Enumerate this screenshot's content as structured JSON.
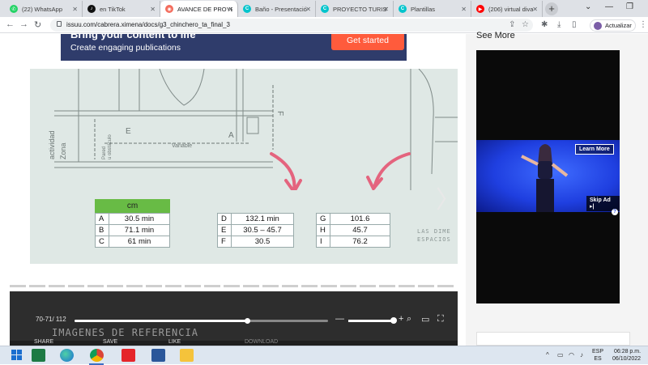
{
  "browser": {
    "tabs": [
      {
        "label": "(22) WhatsApp",
        "icon": "whatsapp-icon",
        "color": "#25d366"
      },
      {
        "label": "en TikTok",
        "icon": "tiktok-icon",
        "color": "#111111"
      },
      {
        "label": "AVANCE DE PROYE",
        "icon": "issuu-icon",
        "color": "#f36d5d"
      },
      {
        "label": "Baño - Presentació",
        "icon": "canva-icon",
        "color": "#00c4cc"
      },
      {
        "label": "PROYECTO TURIST",
        "icon": "canva-icon",
        "color": "#00c4cc"
      },
      {
        "label": "Plantillas",
        "icon": "canva-icon",
        "color": "#00c4cc"
      },
      {
        "label": "(206) virtual diva",
        "icon": "youtube-icon",
        "color": "#ff0000"
      }
    ],
    "active_tab_index": 2,
    "new_tab": "+",
    "window_controls": {
      "tab_search": "⌄",
      "minimize": "—",
      "restore": "❐"
    },
    "url": "issuu.com/cabrera.ximena/docs/g3_chinchero_ta_final_3",
    "update_label": "Actualizar"
  },
  "promo": {
    "title": "Bring your content to life",
    "subtitle": "Create engaging publications",
    "cta": "Get started",
    "bg_color": "#2f3c6b",
    "cta_color": "#ff5b3c"
  },
  "document": {
    "table_header": "cm",
    "table1": [
      [
        "A",
        "30.5 min"
      ],
      [
        "B",
        "71.1 min"
      ],
      [
        "C",
        "61 min"
      ]
    ],
    "table2": [
      [
        "D",
        "132.1 min"
      ],
      [
        "E",
        "30.5 – 45.7"
      ],
      [
        "F",
        "30.5"
      ]
    ],
    "table3": [
      [
        "G",
        "101.6"
      ],
      [
        "H",
        "45.7"
      ],
      [
        "I",
        "76.2"
      ]
    ],
    "drawing_labels": {
      "zona_actividad": "Zona actividad",
      "pared": "Pared u obstáculo",
      "variable": "Variable",
      "letter_e": "E",
      "letter_a": "A",
      "letter_f": "F",
      "espacios": "LAS DIME ESPACIOS"
    }
  },
  "player": {
    "page_count": "70-71/ 112",
    "progress_fraction": 0.68,
    "reference_title": "IMAGENES DE REFERENCIA",
    "share_label": "SHARE",
    "save_label": "SAVE",
    "like_label": "LIKE",
    "download_label": "DOWNLOAD"
  },
  "sidebar": {
    "see_more": "See More",
    "ad_learn_more": "Learn More",
    "ad_skip": "Skip Ad ▸|",
    "ad_info": "?"
  },
  "taskbar": {
    "lang_top": "ESP",
    "lang_bottom": "ES",
    "time": "06:28 p.m.",
    "date": "06/10/2022"
  }
}
